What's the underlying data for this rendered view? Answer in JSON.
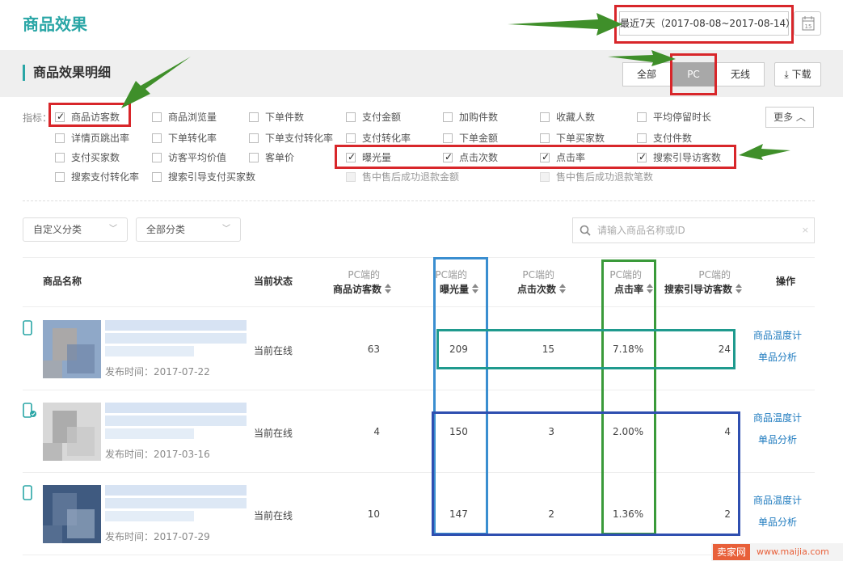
{
  "header": {
    "title": "商品效果",
    "date_range": "最近7天（2017-08-08~2017-08-14）",
    "calendar_day": "15"
  },
  "section": {
    "title": "商品效果明细",
    "segments": [
      "全部",
      "PC",
      "无线"
    ],
    "active_segment": "PC",
    "download_label": "下载"
  },
  "indicators": {
    "label": "指标：",
    "more_label": "更多",
    "items": [
      {
        "label": "商品访客数",
        "checked": true,
        "disabled": false
      },
      {
        "label": "商品浏览量",
        "checked": false,
        "disabled": false
      },
      {
        "label": "下单件数",
        "checked": false,
        "disabled": false
      },
      {
        "label": "支付金额",
        "checked": false,
        "disabled": false
      },
      {
        "label": "加购件数",
        "checked": false,
        "disabled": false
      },
      {
        "label": "收藏人数",
        "checked": false,
        "disabled": false
      },
      {
        "label": "平均停留时长",
        "checked": false,
        "disabled": false
      },
      {
        "label": "详情页跳出率",
        "checked": false,
        "disabled": false
      },
      {
        "label": "下单转化率",
        "checked": false,
        "disabled": false
      },
      {
        "label": "下单支付转化率",
        "checked": false,
        "disabled": false
      },
      {
        "label": "支付转化率",
        "checked": false,
        "disabled": false
      },
      {
        "label": "下单金额",
        "checked": false,
        "disabled": false
      },
      {
        "label": "下单买家数",
        "checked": false,
        "disabled": false
      },
      {
        "label": "支付件数",
        "checked": false,
        "disabled": false
      },
      {
        "label": "支付买家数",
        "checked": false,
        "disabled": false
      },
      {
        "label": "访客平均价值",
        "checked": false,
        "disabled": false
      },
      {
        "label": "客单价",
        "checked": false,
        "disabled": false
      },
      {
        "label": "曝光量",
        "checked": true,
        "disabled": false
      },
      {
        "label": "点击次数",
        "checked": true,
        "disabled": false
      },
      {
        "label": "点击率",
        "checked": true,
        "disabled": false
      },
      {
        "label": "搜索引导访客数",
        "checked": true,
        "disabled": false
      },
      {
        "label": "搜索支付转化率",
        "checked": false,
        "disabled": false
      },
      {
        "label": "搜索引导支付买家数",
        "checked": false,
        "disabled": false
      },
      {
        "label": "售中售后成功退款金额",
        "checked": false,
        "disabled": true
      },
      {
        "label": "售中售后成功退款笔数",
        "checked": false,
        "disabled": true
      }
    ]
  },
  "filters": {
    "category1": "自定义分类",
    "category2": "全部分类",
    "search_placeholder": "请输入商品名称或ID"
  },
  "table": {
    "columns": {
      "name": "商品名称",
      "status": "当前状态",
      "visitors_top": "PC端的",
      "visitors": "商品访客数",
      "exposure_top": "PC端的",
      "exposure": "曝光量",
      "clicks_top": "PC端的",
      "clicks": "点击次数",
      "ctr_top": "PC端的",
      "ctr": "点击率",
      "search_top": "PC端的",
      "search": "搜索引导访客数",
      "ops": "操作"
    },
    "rows": [
      {
        "published": "发布时间：2017-07-22",
        "status": "当前在线",
        "visitors": "63",
        "exposure": "209",
        "clicks": "15",
        "ctr": "7.18%",
        "search": "24",
        "op1": "商品温度计",
        "op2": "单品分析"
      },
      {
        "published": "发布时间：2017-03-16",
        "status": "当前在线",
        "visitors": "4",
        "exposure": "150",
        "clicks": "3",
        "ctr": "2.00%",
        "search": "4",
        "op1": "商品温度计",
        "op2": "单品分析"
      },
      {
        "published": "发布时间：2017-07-29",
        "status": "当前在线",
        "visitors": "10",
        "exposure": "147",
        "clicks": "2",
        "ctr": "1.36%",
        "search": "2",
        "op1": "商品温度计",
        "op2": "单品分析"
      }
    ]
  },
  "watermark": {
    "logo": "卖家网",
    "url": "www.maijia.com"
  },
  "colors": {
    "accent": "#2aa6a6",
    "link": "#1f7bbf",
    "annotation_red": "#d8262a",
    "arrow_green": "#3f8f2a"
  }
}
